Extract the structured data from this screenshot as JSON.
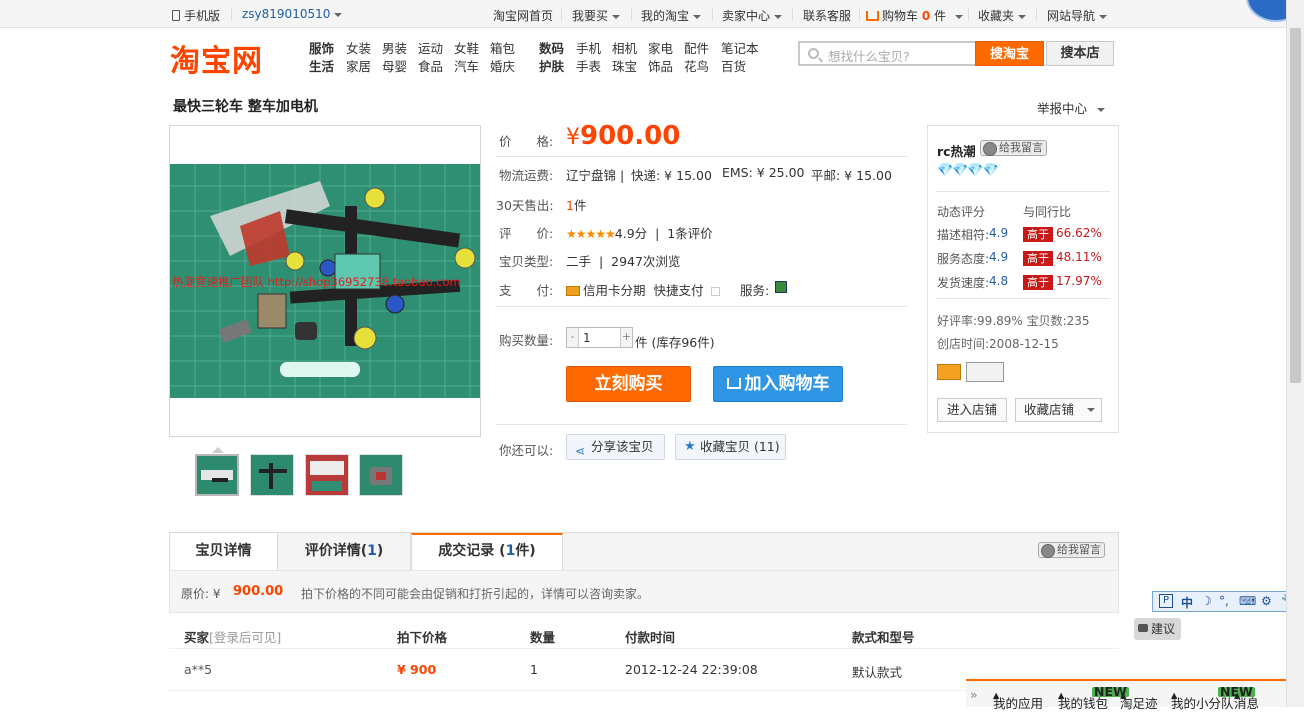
{
  "topbar": {
    "mobile": "手机版",
    "user": "zsy819010510",
    "home": "淘宝网首页",
    "buy": "我要买",
    "mytaobao": "我的淘宝",
    "seller_center": "卖家中心",
    "service": "联系客服",
    "cart": "购物车",
    "cart_count": "0",
    "cart_unit": "件",
    "favorites": "收藏夹",
    "sitenav": "网站导航"
  },
  "logo": "淘宝网",
  "categories": {
    "row1": [
      "服饰",
      "女装",
      "男装",
      "运动",
      "女鞋",
      "箱包",
      "数码",
      "手机",
      "相机",
      "家电",
      "配件",
      "笔记本"
    ],
    "row2": [
      "生活",
      "家居",
      "母婴",
      "食品",
      "汽车",
      "婚庆",
      "护肤",
      "手表",
      "珠宝",
      "饰品",
      "花鸟",
      "百货"
    ]
  },
  "search": {
    "placeholder": "想找什么宝贝?",
    "btn_taobao": "搜淘宝",
    "btn_shop": "搜本店"
  },
  "product": {
    "title": "最快三轮车 整车加电机",
    "report": "举报中心",
    "watermark": "热潮竞速推广团队 http://shop36952738.taobao.com"
  },
  "detail": {
    "price_label": "价　　格:",
    "price_symbol": "¥",
    "price": "900.00",
    "shipping_label": "物流运费:",
    "shipping_origin": "辽宁盘锦",
    "express": "快递: ¥ 15.00",
    "ems": "EMS: ¥ 25.00",
    "mail": "平邮: ¥ 15.00",
    "sold_label": "30天售出:",
    "sold_num": "1",
    "sold_unit": "件",
    "rating_label": "评　　价:",
    "stars": "★★★★★",
    "score": "4.9分",
    "reviews": "1条评价",
    "type_label": "宝贝类型:",
    "type": "二手",
    "views": "2947次浏览",
    "pay_label": "支　　付:",
    "credit": "信用卡分期",
    "quickpay": "快捷支付",
    "service_label": "服务:",
    "qty_label": "购买数量:",
    "qty": "1",
    "stock": "件 (库存96件)",
    "buy_now": "立刻购买",
    "add_cart": "加入购物车",
    "also_label": "你还可以:",
    "share": "分享该宝贝",
    "collect": "收藏宝贝 (11)"
  },
  "seller": {
    "name": "rc热潮",
    "msg_btn": "给我留言",
    "dyn_label": "动态评分",
    "compare_label": "与同行比",
    "rows": [
      {
        "name": "描述相符:",
        "score": "4.9",
        "tag": "高于",
        "pct": "66.62%"
      },
      {
        "name": "服务态度:",
        "score": "4.9",
        "tag": "高于",
        "pct": "48.11%"
      },
      {
        "name": "发货速度:",
        "score": "4.8",
        "tag": "高于",
        "pct": "17.97%"
      }
    ],
    "good_rate": "好评率:99.89% 宝贝数:235",
    "created": "创店时间:2008-12-15",
    "enter_shop": "进入店铺",
    "fav_shop": "收藏店铺"
  },
  "tabs": {
    "t1": "宝贝详情",
    "t2_a": "评价详情(",
    "t2_n": "1",
    "t2_b": ")",
    "t3_a": "成交记录 (",
    "t3_n": "1",
    "t3_b": "件)",
    "msg_btn": "给我留言"
  },
  "notice": {
    "label": "原价: ¥",
    "price": "900.00",
    "text": "拍下价格的不同可能会由促销和打折引起的，详情可以咨询卖家。"
  },
  "records": {
    "headers": {
      "buyer": "买家",
      "buyer_note": "[登录后可见]",
      "price": "拍下价格",
      "qty": "数量",
      "time": "付款时间",
      "model": "款式和型号"
    },
    "rows": [
      {
        "buyer": "a**5",
        "price": "¥ 900",
        "qty": "1",
        "time": "2012-12-24 22:39:08",
        "model": "默认款式"
      }
    ]
  },
  "ime": [
    "中",
    "☽",
    "°,",
    "⌨",
    "⚙",
    "🔧"
  ],
  "suggest": "建议",
  "bottombar": {
    "apps": "我的应用",
    "wallet": "我的钱包",
    "footprint": "淘足迹",
    "team": "我的小分队",
    "msg": "消息",
    "new": "NEW"
  },
  "colors": {
    "accent": "#ff4400",
    "buy": "#ff6a00",
    "cart": "#2f96e6",
    "tag": "#c81818"
  }
}
